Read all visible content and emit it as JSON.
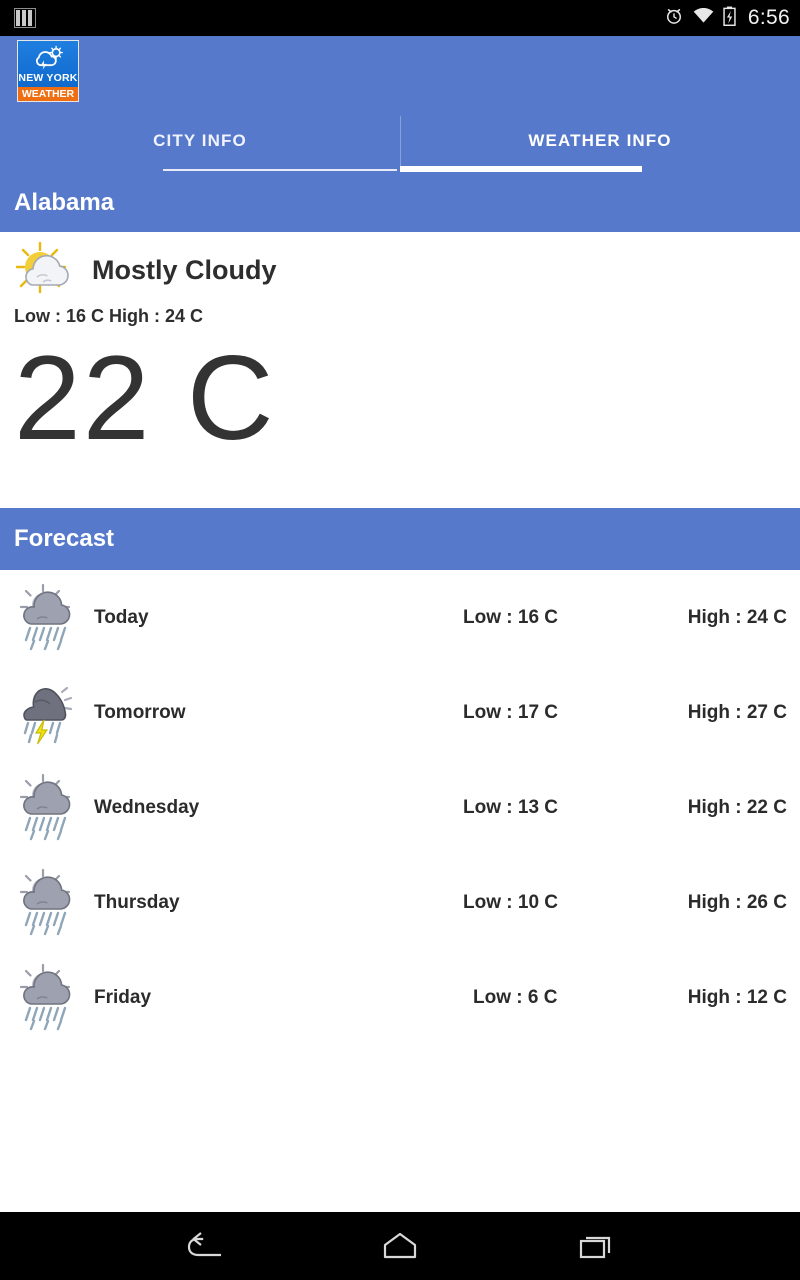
{
  "statusbar": {
    "signal_icon": "sim-bars-icon",
    "alarm_icon": "alarm-clock-icon",
    "wifi_icon": "wifi-icon",
    "battery_icon": "battery-charging-icon",
    "time": "6:56"
  },
  "appbar": {
    "logo": {
      "city_label": "NEW YORK",
      "weather_label": "WEATHER",
      "glyph": "cloud-sun-lightning-icon",
      "background_color": "#0b63c6",
      "accent_color": "#ef6e12"
    },
    "background_color": "#5779cb"
  },
  "tabs": [
    {
      "label": "CITY INFO",
      "active": false
    },
    {
      "label": "WEATHER INFO",
      "active": true
    }
  ],
  "city_section": {
    "title": "Alabama"
  },
  "current_weather": {
    "icon": "sun-behind-cloud-icon",
    "condition": "Mostly Cloudy",
    "low_high": "Low : 16 C   High : 24 C",
    "temperature": "22 C"
  },
  "forecast_section": {
    "title": "Forecast",
    "rows": [
      {
        "icon": "rain-sun-cloud-icon",
        "day": "Today",
        "low": "Low : 16 C",
        "high": "High : 24 C"
      },
      {
        "icon": "thunderstorm-icon",
        "day": "Tomorrow",
        "low": "Low : 17 C",
        "high": "High : 27 C"
      },
      {
        "icon": "rain-sun-cloud-icon",
        "day": "Wednesday",
        "low": "Low : 13 C",
        "high": "High : 22 C"
      },
      {
        "icon": "rain-sun-cloud-icon",
        "day": "Thursday",
        "low": "Low : 10 C",
        "high": "High : 26 C"
      },
      {
        "icon": "rain-sun-cloud-icon",
        "day": "Friday",
        "low": "Low : 6 C",
        "high": "High : 12 C"
      }
    ]
  },
  "navbar": {
    "back_icon": "back-arrow-icon",
    "home_icon": "home-icon",
    "recents_icon": "recent-apps-icon"
  }
}
